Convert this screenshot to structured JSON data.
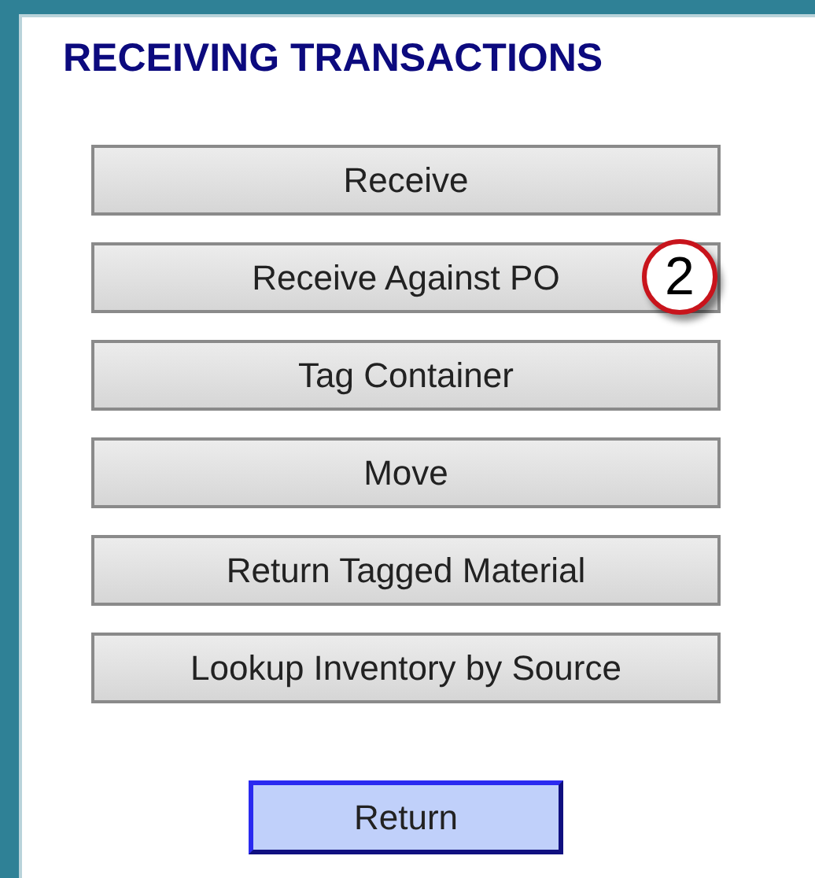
{
  "title": "RECEIVING TRANSACTIONS",
  "buttons": [
    {
      "label": "Receive"
    },
    {
      "label": "Receive Against PO",
      "callout": "2"
    },
    {
      "label": "Tag Container"
    },
    {
      "label": "Move"
    },
    {
      "label": "Return Tagged Material"
    },
    {
      "label": "Lookup Inventory by Source"
    }
  ],
  "return_button": {
    "label": "Return"
  }
}
